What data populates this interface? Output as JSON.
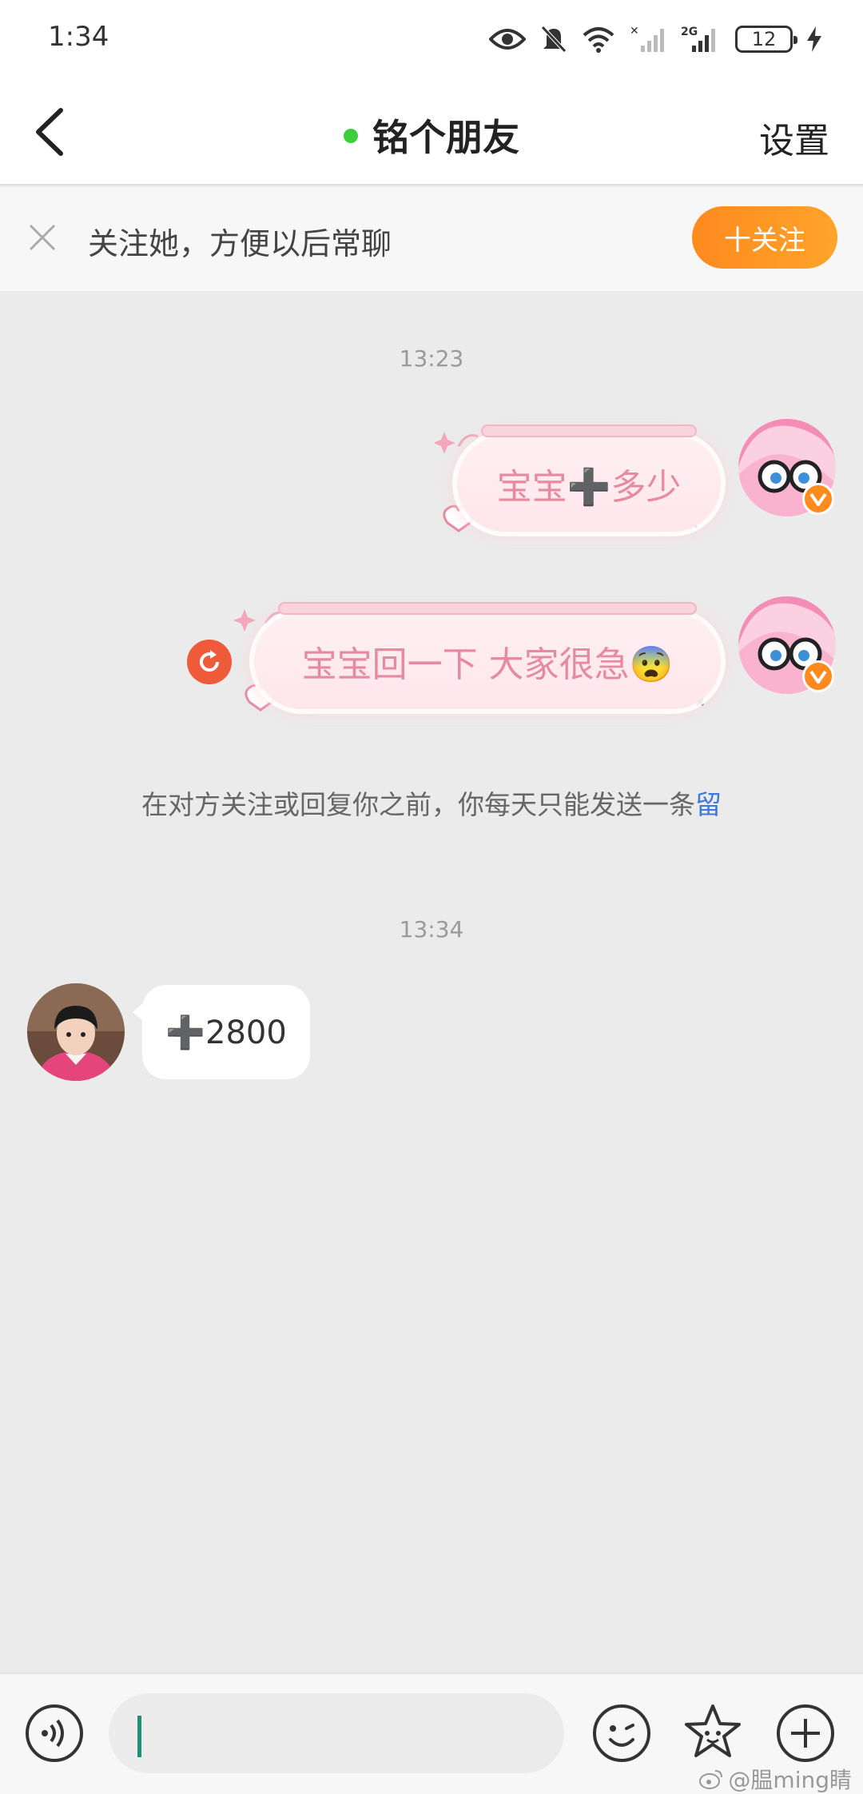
{
  "status_bar": {
    "time": "1:34",
    "network_label": "2G",
    "battery_level": "12"
  },
  "nav": {
    "title": "铭个朋友",
    "settings_label": "设置",
    "online_color": "#3ccf3c"
  },
  "follow_banner": {
    "text": "关注她，方便以后常聊",
    "follow_button_label": "十关注"
  },
  "chat": {
    "timestamps": [
      "13:23",
      "13:34"
    ],
    "messages": [
      {
        "sender": "me",
        "text": "宝宝➕多少",
        "style": "pink-decorated"
      },
      {
        "sender": "me",
        "text": "宝宝回一下 大家很急😨",
        "style": "pink-decorated",
        "failed": true
      },
      {
        "sender": "other",
        "text": "➕2800",
        "style": "plain"
      }
    ],
    "system_notice": "在对方关注或回复你之前，你每天只能发送一条",
    "system_notice_link": "留"
  },
  "input_bar": {
    "placeholder": "",
    "icons": [
      "voice-icon",
      "emoji-icon",
      "sticker-icon",
      "plus-icon"
    ]
  },
  "watermark": "@腽ming睛"
}
